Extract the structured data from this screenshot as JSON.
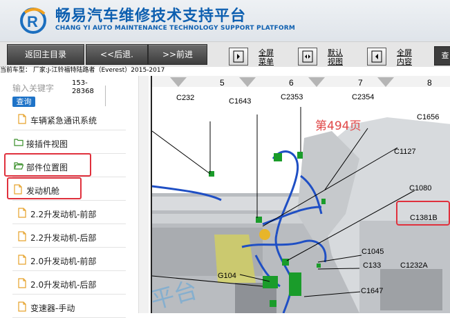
{
  "header": {
    "title_cn": "畅易汽车维修技术支持平台",
    "title_en": "CHANG YI AUTO MAINTENANCE TECHNOLOGY SUPPORT PLATFORM"
  },
  "toolbar": {
    "back_main": "返回主目录",
    "back": "<<后退.",
    "forward": ">>前进",
    "fullscreen_menu": [
      "全屏",
      "菜单"
    ],
    "default_view": [
      "默认",
      "视图"
    ],
    "fullscreen_content": [
      "全屏",
      "内容"
    ],
    "search_short": "查"
  },
  "vehicle_info": "当前车型： 厂家:J-江铃福特陆路者（Everest）2015-2017",
  "search": {
    "placeholder": "输入关键字",
    "button": "查询",
    "code": [
      "153-",
      "28368"
    ]
  },
  "tree": [
    {
      "label": "车辆紧急通讯系统",
      "icon": "document-icon",
      "indent": 1
    },
    {
      "label": "接插件视图",
      "icon": "folder-icon",
      "indent": 0
    },
    {
      "label": "部件位置图",
      "icon": "folder-open-icon",
      "indent": 0,
      "highlight": true
    },
    {
      "label": "发动机舱",
      "icon": "document-icon",
      "indent": 0,
      "highlight": true
    },
    {
      "label": "2.2升发动机-前部",
      "icon": "document-icon",
      "indent": 1
    },
    {
      "label": "2.2升发动机-后部",
      "icon": "document-icon",
      "indent": 1
    },
    {
      "label": "2.0升发动机-前部",
      "icon": "document-icon",
      "indent": 1
    },
    {
      "label": "2.0升发动机-后部",
      "icon": "document-icon",
      "indent": 1
    },
    {
      "label": "变速器-手动",
      "icon": "document-icon",
      "indent": 1
    }
  ],
  "diagram": {
    "columns": [
      "5",
      "6",
      "7",
      "8"
    ],
    "page_label": "第494页",
    "connectors": [
      "C232",
      "C1643",
      "C2353",
      "C2354",
      "C1656",
      "C1127",
      "C1080",
      "C1381B",
      "C1045",
      "C133",
      "C1232A",
      "G104",
      "C1647"
    ],
    "highlighted_connector": "C1381B",
    "watermark": "平台"
  },
  "colors": {
    "brand_blue": "#0d5fb0",
    "highlight_red": "#e0303c",
    "page_label_red": "#e04848",
    "wire_blue": "#1f4fc4",
    "connector_green": "#1a9c2a"
  }
}
